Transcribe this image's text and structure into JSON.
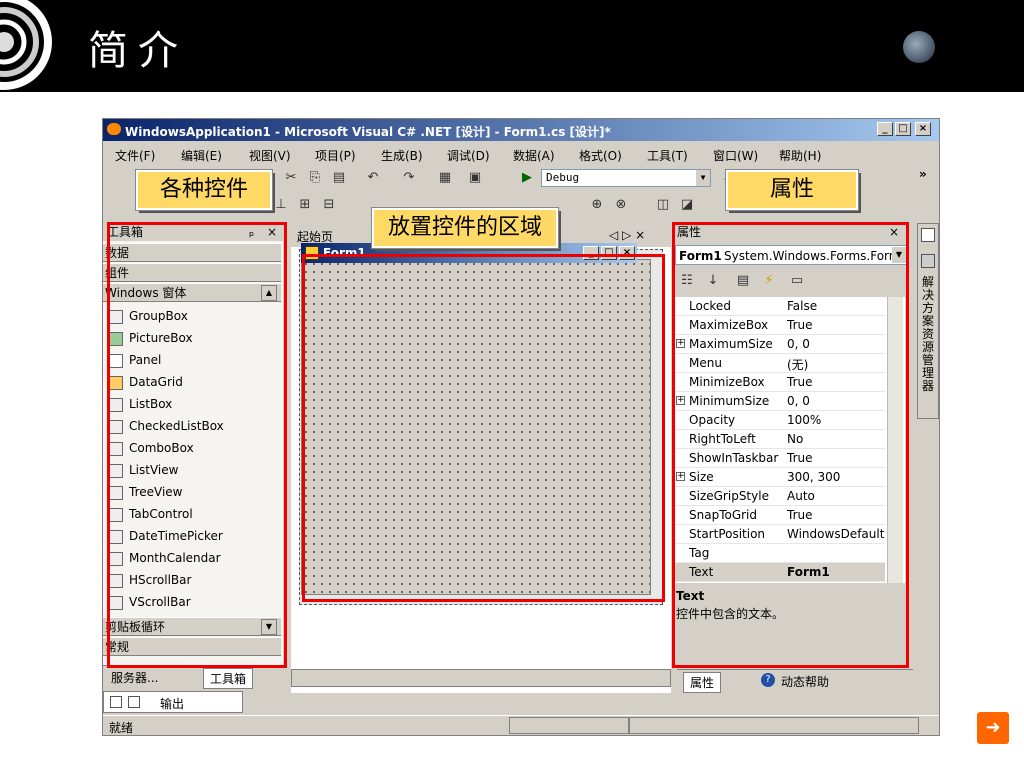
{
  "slide": {
    "title": "简介"
  },
  "window": {
    "title": "WindowsApplication1 - Microsoft Visual C# .NET [设计] - Form1.cs [设计]*",
    "controls": [
      "_",
      "□",
      "×"
    ]
  },
  "menu": [
    "文件(F)",
    "编辑(E)",
    "视图(V)",
    "项目(P)",
    "生成(B)",
    "调试(D)",
    "数据(A)",
    "格式(O)",
    "工具(T)",
    "窗口(W)",
    "帮助(H)"
  ],
  "toolbar": {
    "config": "Debug",
    "overflow": "»"
  },
  "callouts": {
    "controls": "各种控件",
    "properties": "属性",
    "area": "放置控件的区域"
  },
  "toolbox": {
    "title": "工具箱",
    "pin": "ₚ",
    "close": "×",
    "sections_top": [
      "数据",
      "组件",
      "Windows 窗体"
    ],
    "items": [
      "GroupBox",
      "PictureBox",
      "Panel",
      "DataGrid",
      "ListBox",
      "CheckedListBox",
      "ComboBox",
      "ListView",
      "TreeView",
      "TabControl",
      "DateTimePicker",
      "MonthCalendar",
      "HScrollBar",
      "VScrollBar"
    ],
    "sections_bottom": [
      "剪贴板循环",
      "常规"
    ],
    "tabs": [
      "服务器...",
      "工具箱"
    ]
  },
  "designer": {
    "tab": "起始页",
    "nav": "◁ ▷ ×",
    "form_title": "Form1"
  },
  "properties": {
    "title": "属性",
    "object": "Form1",
    "object_type": "System.Windows.Forms.Forr",
    "rows": [
      {
        "name": "Locked",
        "value": "False"
      },
      {
        "name": "MaximizeBox",
        "value": "True"
      },
      {
        "name": "MaximumSize",
        "value": "0, 0"
      },
      {
        "name": "Menu",
        "value": "(无)"
      },
      {
        "name": "MinimizeBox",
        "value": "True"
      },
      {
        "name": "MinimumSize",
        "value": "0, 0"
      },
      {
        "name": "Opacity",
        "value": "100%"
      },
      {
        "name": "RightToLeft",
        "value": "No"
      },
      {
        "name": "ShowInTaskbar",
        "value": "True"
      },
      {
        "name": "Size",
        "value": "300, 300"
      },
      {
        "name": "SizeGripStyle",
        "value": "Auto"
      },
      {
        "name": "SnapToGrid",
        "value": "True"
      },
      {
        "name": "StartPosition",
        "value": "WindowsDefaultLc"
      },
      {
        "name": "Tag",
        "value": ""
      },
      {
        "name": "Text",
        "value": "Form1"
      }
    ],
    "desc_title": "Text",
    "desc_text": "控件中包含的文本。",
    "tabs": [
      "属性",
      "动态帮助"
    ]
  },
  "side_tab": "解决方案资源管理器",
  "output": {
    "tab": "输出"
  },
  "status": "就绪"
}
